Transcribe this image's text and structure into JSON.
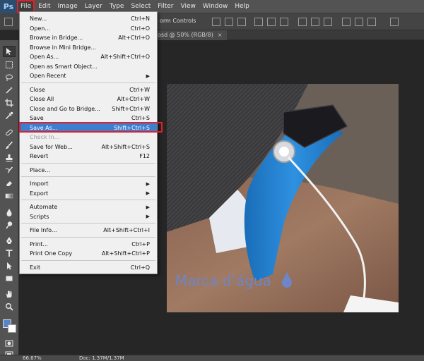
{
  "app": {
    "logo": "Ps"
  },
  "menubar": {
    "items": [
      "File",
      "Edit",
      "Image",
      "Layer",
      "Type",
      "Select",
      "Filter",
      "View",
      "Window",
      "Help"
    ]
  },
  "options_bar": {
    "transform_controls": "orm Controls"
  },
  "document_tab": {
    "label": "osd @ 50% (RGB/8)",
    "close": "×"
  },
  "file_menu": {
    "groups": [
      [
        {
          "label": "New...",
          "shortcut": "Ctrl+N"
        },
        {
          "label": "Open...",
          "shortcut": "Ctrl+O"
        },
        {
          "label": "Browse in Bridge...",
          "shortcut": "Alt+Ctrl+O"
        },
        {
          "label": "Browse in Mini Bridge...",
          "shortcut": ""
        },
        {
          "label": "Open As...",
          "shortcut": "Alt+Shift+Ctrl+O"
        },
        {
          "label": "Open as Smart Object...",
          "shortcut": ""
        },
        {
          "label": "Open Recent",
          "shortcut": "",
          "submenu": true
        }
      ],
      [
        {
          "label": "Close",
          "shortcut": "Ctrl+W"
        },
        {
          "label": "Close All",
          "shortcut": "Alt+Ctrl+W"
        },
        {
          "label": "Close and Go to Bridge...",
          "shortcut": "Shift+Ctrl+W"
        },
        {
          "label": "Save",
          "shortcut": "Ctrl+S"
        },
        {
          "label": "Save As...",
          "shortcut": "Shift+Ctrl+S",
          "highlighted": true
        },
        {
          "label": "Check In...",
          "shortcut": "",
          "disabled": true
        },
        {
          "label": "Save for Web...",
          "shortcut": "Alt+Shift+Ctrl+S"
        },
        {
          "label": "Revert",
          "shortcut": "F12"
        }
      ],
      [
        {
          "label": "Place...",
          "shortcut": ""
        }
      ],
      [
        {
          "label": "Import",
          "shortcut": "",
          "submenu": true
        },
        {
          "label": "Export",
          "shortcut": "",
          "submenu": true
        }
      ],
      [
        {
          "label": "Automate",
          "shortcut": "",
          "submenu": true
        },
        {
          "label": "Scripts",
          "shortcut": "",
          "submenu": true
        }
      ],
      [
        {
          "label": "File Info...",
          "shortcut": "Alt+Shift+Ctrl+I"
        }
      ],
      [
        {
          "label": "Print...",
          "shortcut": "Ctrl+P"
        },
        {
          "label": "Print One Copy",
          "shortcut": "Alt+Shift+Ctrl+P"
        }
      ],
      [
        {
          "label": "Exit",
          "shortcut": "Ctrl+Q"
        }
      ]
    ]
  },
  "canvas": {
    "watermark_text": "Marca d’água"
  },
  "status_bar": {
    "zoom": "66.67%",
    "doc_size": "Doc: 1.37M/1.37M"
  },
  "colors": {
    "menu_highlight": "#3c7fd1",
    "outline_red": "#e0202a",
    "watermark_blue": "#6e86c8",
    "band_blue": "#2e86d4",
    "foreground_color": "#5a83c7",
    "background_color": "#ffffff"
  },
  "toolbar": {
    "tools": [
      "move-tool-icon",
      "marquee-tool-icon",
      "lasso-tool-icon",
      "magic-wand-tool-icon",
      "crop-tool-icon",
      "eyedropper-tool-icon",
      "healing-brush-tool-icon",
      "brush-tool-icon",
      "clone-stamp-tool-icon",
      "history-brush-tool-icon",
      "eraser-tool-icon",
      "gradient-tool-icon",
      "blur-tool-icon",
      "dodge-tool-icon",
      "pen-tool-icon",
      "type-tool-icon",
      "path-selection-tool-icon",
      "shape-tool-icon",
      "hand-tool-icon",
      "zoom-tool-icon"
    ]
  }
}
